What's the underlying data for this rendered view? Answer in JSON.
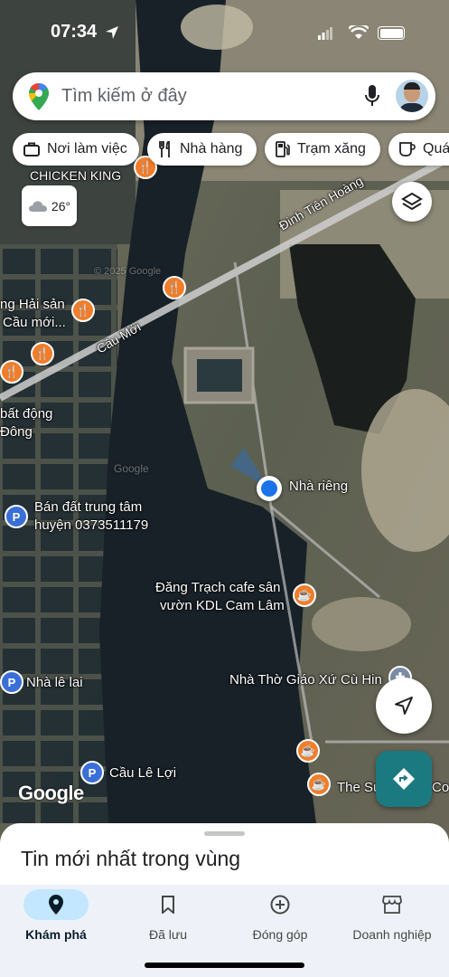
{
  "status_bar": {
    "time": "07:34"
  },
  "search": {
    "placeholder": "Tìm kiếm ở đây"
  },
  "chips": [
    {
      "label": "Nơi làm việc",
      "icon": "briefcase-icon"
    },
    {
      "label": "Nhà hàng",
      "icon": "restaurant-icon"
    },
    {
      "label": "Trạm xăng",
      "icon": "gas-station-icon"
    },
    {
      "label": "Quá",
      "icon": "coffee-icon"
    }
  ],
  "weather": {
    "temp": "26°",
    "icon": "cloud-icon"
  },
  "map": {
    "labels": {
      "chicken_king": "CHICKEN KING",
      "dinh_tien_hoang": "Đinh Tiên Hoàng",
      "cau_moi": "Cầu Mới",
      "hai_san_line1": "ng Hải sản",
      "hai_san_line2": "Cầu mới...",
      "bat_dong_line1": "bất động",
      "bat_dong_line2": "Đông",
      "ban_dat_line1": "Bán đất trung tâm",
      "ban_dat_line2": "huyện 0373511179",
      "nha_rieng": "Nhà riêng",
      "dang_trach_line1": "Đăng Trạch cafe sân",
      "dang_trach_line2": "vườn KDL Cam Lâm",
      "nha_tho": "Nhà Thờ Giáo Xứ Cù Hin",
      "nha_le_lai": "Nhà lê lai",
      "cau_le_loi": "Cầu Lê Lợi",
      "the_su": "The Su",
      "co": "Co",
      "google": "Google",
      "copyright": "© 2025 Google",
      "watermark": "Google"
    },
    "location_color": "#1a73e8"
  },
  "sheet": {
    "title": "Tin mới nhất trong vùng"
  },
  "nav": [
    {
      "label": "Khám phá",
      "icon": "location-pin-icon",
      "active": true
    },
    {
      "label": "Đã lưu",
      "icon": "bookmark-icon",
      "active": false
    },
    {
      "label": "Đóng góp",
      "icon": "add-circle-icon",
      "active": false
    },
    {
      "label": "Doanh nghiệp",
      "icon": "storefront-icon",
      "active": false
    }
  ]
}
